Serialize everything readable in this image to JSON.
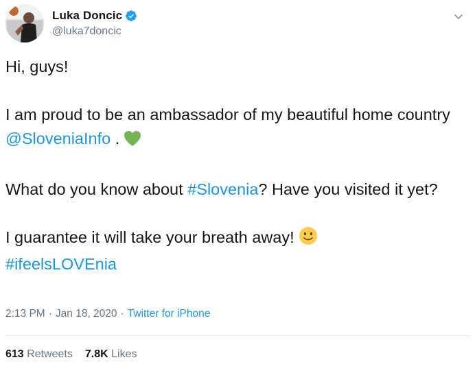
{
  "user": {
    "display_name": "Luka Doncic",
    "handle": "@luka7doncic",
    "verified": true
  },
  "tweet": {
    "line1": "Hi, guys!",
    "p2_text": "I am proud to be an ambassador of my beautiful home country ",
    "p2_mention": "@SloveniaInfo",
    "p2_end": " .",
    "p3_start": "What do you know about ",
    "p3_hashtag": "#Slovenia",
    "p3_end": "? Have you visited it yet?",
    "p4_text": "I guarantee it will take your breath away!",
    "p4_hashtag": "#ifeelsLOVEnia"
  },
  "meta": {
    "time": "2:13 PM",
    "separator": "·",
    "date": "Jan 18, 2020",
    "source": "Twitter for iPhone"
  },
  "stats": {
    "retweets_count": "613",
    "retweets_label": "Retweets",
    "likes_count": "7.8K",
    "likes_label": "Likes"
  },
  "icons": {
    "verified": "verified-badge-icon",
    "more": "chevron-down-icon",
    "heart": "green-heart-emoji",
    "smile": "slightly-smiling-face-emoji"
  },
  "colors": {
    "link": "#1b95e0",
    "verified": "#1da1f2",
    "green_heart": "#77b255",
    "smile": "#ffcc4d",
    "secondary_text": "#657786"
  }
}
